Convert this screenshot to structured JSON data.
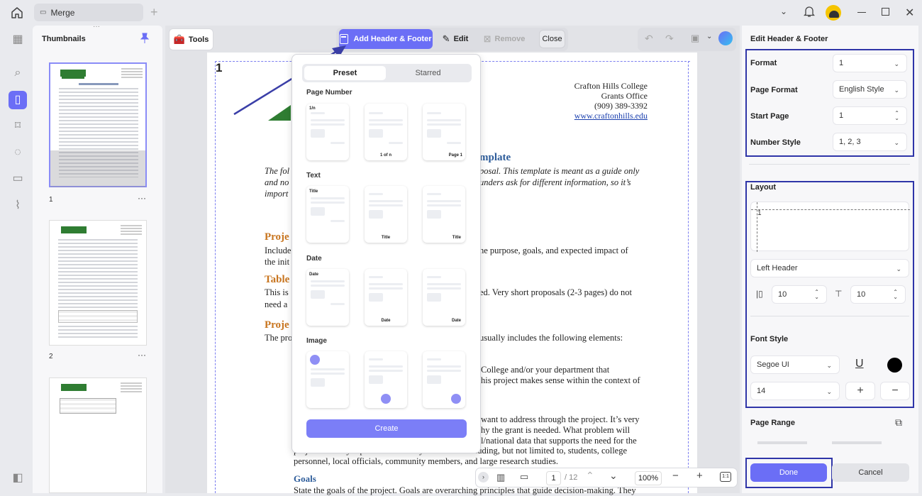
{
  "titlebar": {
    "tab_label": "Merge"
  },
  "thumbnails": {
    "title": "Thumbnails",
    "pages": [
      "1",
      "2"
    ]
  },
  "toolbar": {
    "tools_label": "Tools",
    "add_header_footer_label": "Add Header & Footer",
    "edit_label": "Edit",
    "remove_label": "Remove",
    "close_label": "Close"
  },
  "popup": {
    "tabs": [
      "Preset",
      "Starred"
    ],
    "sections": [
      "Page Number",
      "Text",
      "Date",
      "Image"
    ],
    "page_number_cards": [
      "1/n",
      "1 of n",
      "Page 1"
    ],
    "text_cards": [
      "Title",
      "Title",
      "Title"
    ],
    "date_cards": [
      "Date",
      "Date",
      "Date"
    ],
    "create_label": "Create"
  },
  "document": {
    "page_number_marker": "1",
    "address": [
      "Crafton Hills College",
      "Grants Office",
      "(909) 389-3392",
      "www.craftonhills.edu"
    ],
    "heading_fragment": "mplate",
    "intro_lines": [
      {
        "left": "The fol",
        "right": "posal. This template is meant as a guide only"
      },
      {
        "left": "and no",
        "right": "unders ask for different information, so it’s"
      },
      {
        "left": "import",
        "right": ""
      }
    ],
    "section1": {
      "heading": "Proje",
      "lines": [
        {
          "left": "Include",
          "right": "he purpose, goals, and expected impact of"
        },
        {
          "left": "the init",
          "right": ""
        }
      ]
    },
    "section2": {
      "heading": "Table",
      "lines": [
        {
          "left": "This is",
          "right": "ed. Very short proposals (2-3 pages) do not"
        },
        {
          "left": "need a",
          "right": ""
        }
      ]
    },
    "section3": {
      "heading": "Proje",
      "lines": [
        {
          "left": "The pro",
          "right": "usually includes the following elements:"
        }
      ]
    },
    "para4": [
      "College and/or your department that",
      "his project makes sense within the context of"
    ],
    "para5": [
      "want to address through the project. It’s very",
      "hy the grant is needed. What problem will",
      "l/national data that supports the need for the",
      "project. Identify input from a variety of sources including, but not limited to, students, college",
      "personnel, local officials, community members, and large research studies."
    ],
    "goals_heading": "Goals",
    "goals_line": "State the goals of the project. Goals are overarching principles that guide decision-making. They"
  },
  "bottombar": {
    "page_input": "1",
    "page_total": "/ 12",
    "zoom": "100%"
  },
  "rightpanel": {
    "title": "Edit Header & Footer",
    "format_label": "Format",
    "format_value": "1",
    "page_format_label": "Page Format",
    "page_format_value": "English Style",
    "start_page_label": "Start Page",
    "start_page_value": "1",
    "number_style_label": "Number Style",
    "number_style_value": "1, 2, 3",
    "layout_label": "Layout",
    "layout_preview_number": "1",
    "position_value": "Left Header",
    "margin_left_value": "10",
    "margin_top_value": "10",
    "font_style_label": "Font Style",
    "font_value": "Segoe UI",
    "font_size_value": "14",
    "page_range_label": "Page Range",
    "done_label": "Done",
    "cancel_label": "Cancel"
  },
  "colors": {
    "accent": "#6b6ef6",
    "highlight_border": "#2f35a8",
    "arrow": "#3b3fa8"
  }
}
